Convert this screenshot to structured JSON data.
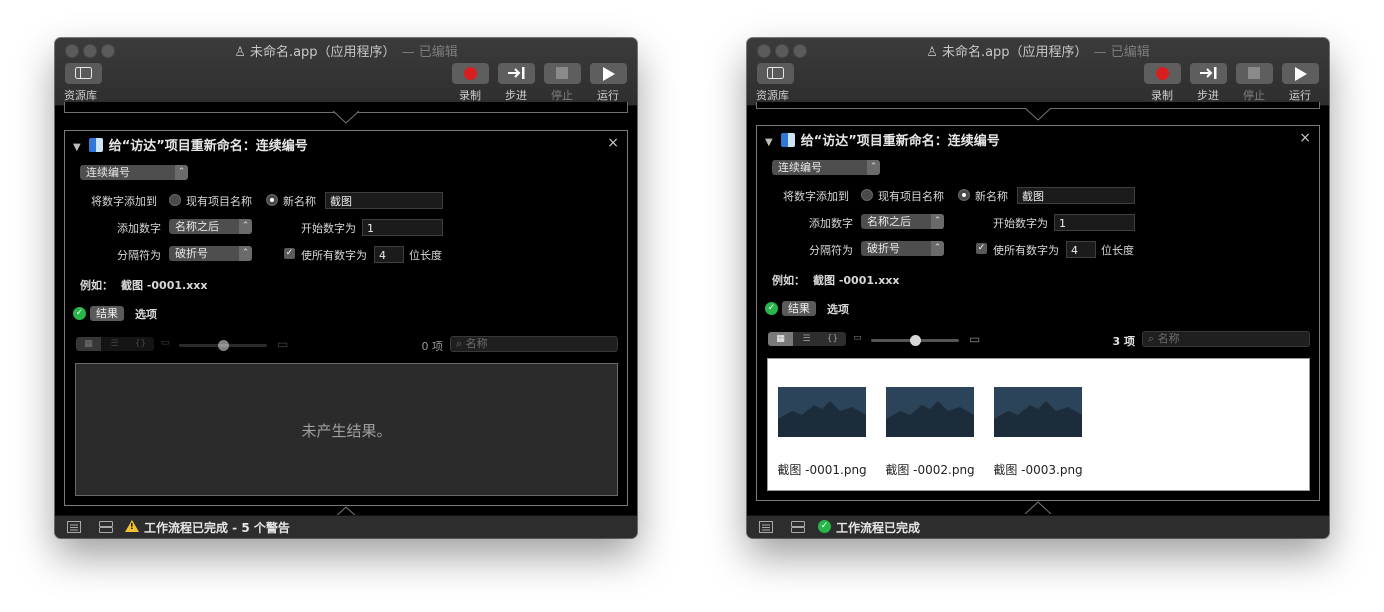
{
  "left": {
    "window_title": "未命名.app（应用程序）",
    "edited": "— 已编辑",
    "toolbar": {
      "library": "资源库",
      "record": "录制",
      "step": "步进",
      "stop": "停止",
      "run": "运行"
    },
    "action": {
      "title": "给“访达”项目重新命名：连续编号",
      "mode_popup": "连续编号",
      "add_number_to_label": "将数字添加到",
      "opt_existing": "现有项目名称",
      "opt_new": "新名称",
      "new_name_value": "截图",
      "add_number_label": "添加数字",
      "position_popup": "名称之后",
      "start_label": "开始数字为",
      "start_value": "1",
      "separator_label": "分隔符为",
      "separator_popup": "破折号",
      "digits_label": "使所有数字为",
      "digits_value": "4",
      "digits_suffix": "位长度",
      "example_label": "例如：",
      "example_value": "截图 -0001.xxx",
      "results_tab": "结果",
      "options_tab": "选项",
      "item_count": "0 项",
      "search_placeholder": "名称",
      "empty_text": "未产生结果。"
    },
    "status": "工作流程已完成 - 5 个警告"
  },
  "right": {
    "window_title": "未命名.app（应用程序）",
    "edited": "— 已编辑",
    "toolbar": {
      "library": "资源库",
      "record": "录制",
      "step": "步进",
      "stop": "停止",
      "run": "运行"
    },
    "action": {
      "title": "给“访达”项目重新命名：连续编号",
      "mode_popup": "连续编号",
      "add_number_to_label": "将数字添加到",
      "opt_existing": "现有项目名称",
      "opt_new": "新名称",
      "new_name_value": "截图",
      "add_number_label": "添加数字",
      "position_popup": "名称之后",
      "start_label": "开始数字为",
      "start_value": "1",
      "separator_label": "分隔符为",
      "separator_popup": "破折号",
      "digits_label": "使所有数字为",
      "digits_value": "4",
      "digits_suffix": "位长度",
      "example_label": "例如：",
      "example_value": "截图 -0001.xxx",
      "results_tab": "结果",
      "options_tab": "选项",
      "item_count": "3 项",
      "search_placeholder": "名称",
      "files": [
        "截图 -0001.png",
        "截图 -0002.png",
        "截图 -0003.png"
      ]
    },
    "status": "工作流程已完成"
  },
  "colors": {
    "record": "#d81e1e",
    "success": "#28b64a",
    "warning": "#f2c230",
    "thumb_bg": "#2c4459"
  }
}
